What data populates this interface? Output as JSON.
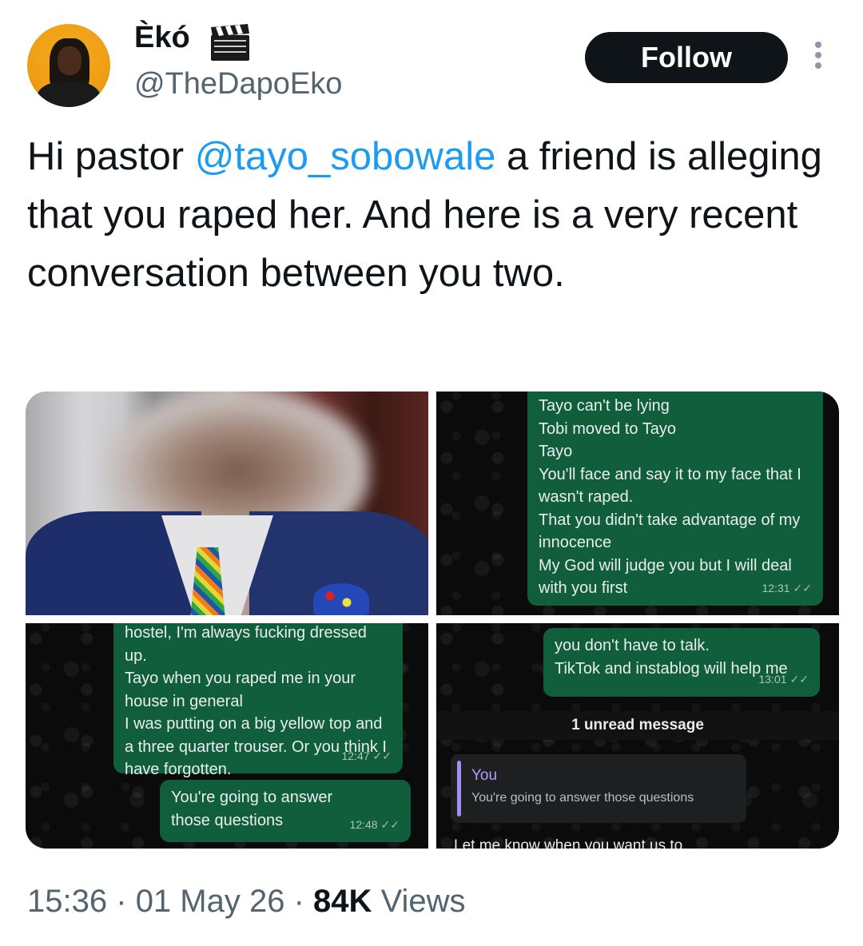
{
  "author": {
    "display_name": "Èkó",
    "handle": "@TheDapoEko",
    "badge_icon": "clapperboard-icon"
  },
  "follow_label": "Follow",
  "more_icon": "more-options-icon",
  "tweet": {
    "text_before": "Hi pastor ",
    "mention": "@tayo_sobowale",
    "text_after": " a friend is alleging that you raped her. And here is a very recent conversation between you two."
  },
  "media": {
    "chat_top_right": {
      "message": "Tayo can't be lying\nTobi moved to Tayo\nTayo\nYou'll face and say it to my face that I wasn't raped.\nThat you didn't take advantage of my innocence\nMy God will judge you but I will deal with you first",
      "time": "12:31"
    },
    "chat_bottom_left": {
      "message1": "hostel, I'm always fucking dressed up.\nTayo when you raped me in your house in general\nI was putting on a big yellow top and a three quarter trouser. Or you think I have forgotten.",
      "time1": "12:47",
      "message2": "You're going to answer those questions",
      "time2": "12:48"
    },
    "chat_bottom_right": {
      "message": "you don't have to talk.\nTikTok and instablog will help me",
      "time": "13:01",
      "unread": "1 unread message",
      "reply_name": "You",
      "reply_quote": "You're going to answer those questions",
      "next_message": "Let me know when you want us to"
    }
  },
  "meta": {
    "time": "15:36",
    "date": "01 May 26",
    "views_count": "84K",
    "views_label": "Views",
    "separator": "·"
  }
}
